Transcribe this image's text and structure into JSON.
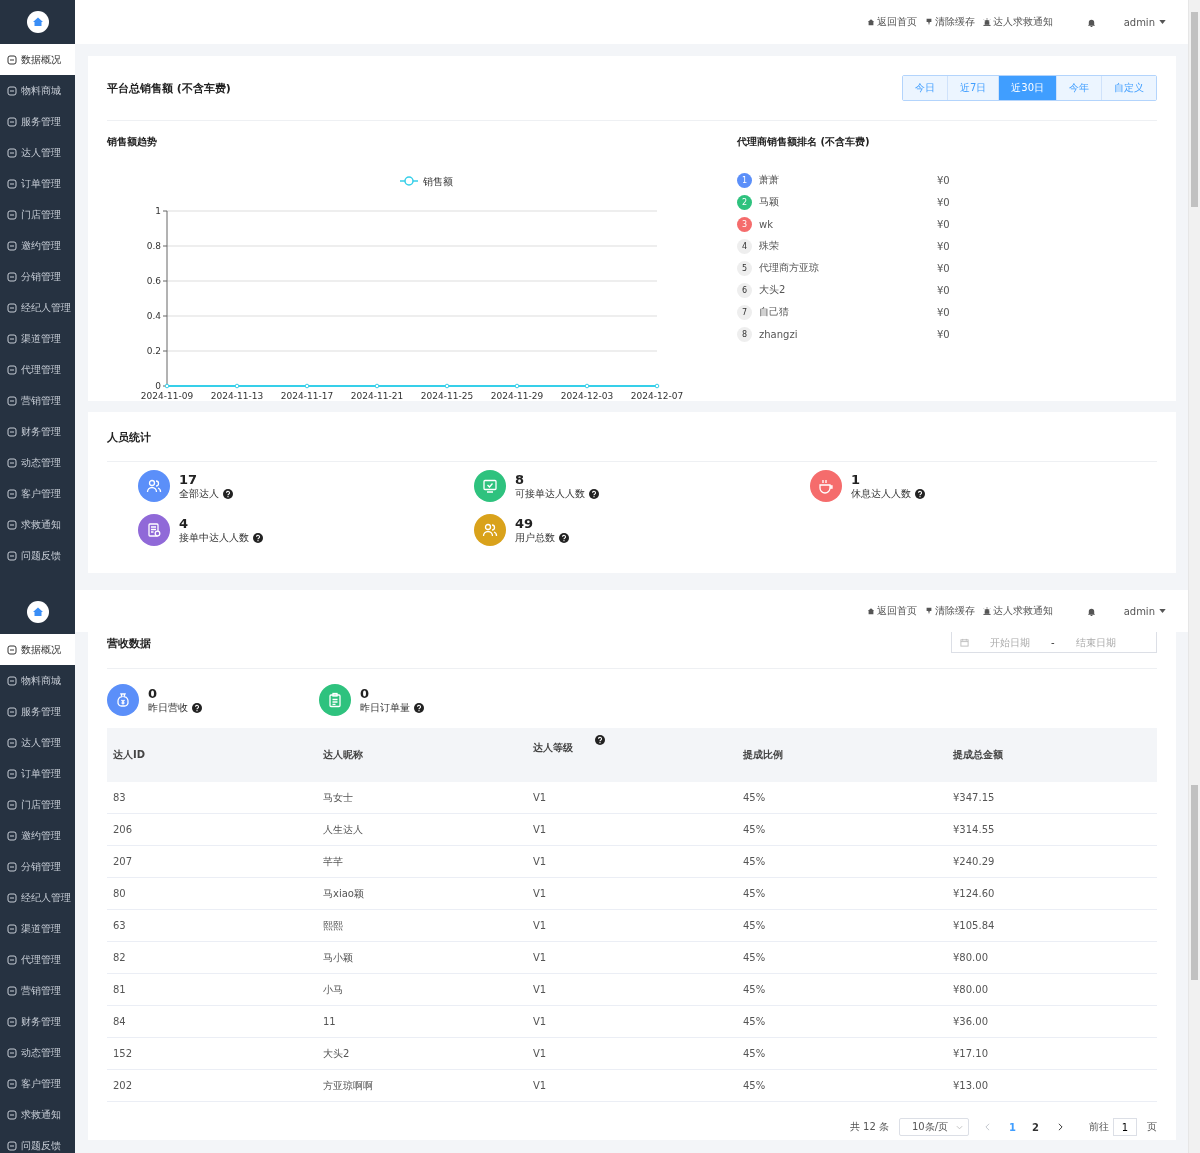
{
  "top_screen": {
    "sidebar": {
      "items": [
        {
          "label": "数据概况",
          "selected": true
        },
        {
          "label": "物料商城",
          "selected": false
        },
        {
          "label": "服务管理",
          "selected": false
        },
        {
          "label": "达人管理",
          "selected": false
        },
        {
          "label": "订单管理",
          "selected": false
        },
        {
          "label": "门店管理",
          "selected": false
        },
        {
          "label": "邀约管理",
          "selected": false
        },
        {
          "label": "分销管理",
          "selected": false
        },
        {
          "label": "经纪人管理",
          "selected": false
        },
        {
          "label": "渠道管理",
          "selected": false
        },
        {
          "label": "代理管理",
          "selected": false
        },
        {
          "label": "营销管理",
          "selected": false
        },
        {
          "label": "财务管理",
          "selected": false
        },
        {
          "label": "动态管理",
          "selected": false
        },
        {
          "label": "客户管理",
          "selected": false
        },
        {
          "label": "求救通知",
          "selected": false
        },
        {
          "label": "问题反馈",
          "selected": false
        }
      ]
    },
    "header": {
      "links": [
        {
          "kind": "home",
          "label": "返回首页"
        },
        {
          "kind": "clear",
          "label": "清除缓存"
        },
        {
          "kind": "alarm",
          "label": "达人求救通知"
        }
      ],
      "user": "admin"
    },
    "sales_card": {
      "title": "平台总销售额 (不含车费)",
      "ranges": [
        {
          "label": "今日",
          "selected": false
        },
        {
          "label": "近7日",
          "selected": false
        },
        {
          "label": "近30日",
          "selected": true
        },
        {
          "label": "今年",
          "selected": false
        },
        {
          "label": "自定义",
          "selected": false
        }
      ],
      "trend": {
        "title": "销售额趋势",
        "chart_data": {
          "type": "line",
          "categories": [
            "2024-11-09",
            "2024-11-13",
            "2024-11-17",
            "2024-11-21",
            "2024-11-25",
            "2024-11-29",
            "2024-12-03",
            "2024-12-07"
          ],
          "series": [
            {
              "name": "销售额",
              "color": "#36cfe9",
              "marker": "circle",
              "values": [
                0,
                0,
                0,
                0,
                0,
                0,
                0,
                0
              ]
            }
          ],
          "ylim": [
            0,
            1
          ],
          "yticks": [
            0,
            0.2,
            0.4,
            0.6,
            0.8,
            1
          ],
          "grid": true
        }
      },
      "ranking": {
        "title": "代理商销售额排名 (不含车费)",
        "rows": [
          {
            "rank": "1",
            "name": "萧萧",
            "amount": "¥0",
            "color": "#5b8ff9"
          },
          {
            "rank": "2",
            "name": "马颖",
            "amount": "¥0",
            "color": "#2ec27e"
          },
          {
            "rank": "3",
            "name": "wk",
            "amount": "¥0",
            "color": "#f56c6c"
          },
          {
            "rank": "4",
            "name": "殊荣",
            "amount": "¥0",
            "color": "#eeeeee"
          },
          {
            "rank": "5",
            "name": "代理商方亚琼",
            "amount": "¥0",
            "color": "#eeeeee"
          },
          {
            "rank": "6",
            "name": "大头2",
            "amount": "¥0",
            "color": "#eeeeee"
          },
          {
            "rank": "7",
            "name": "自己猜",
            "amount": "¥0",
            "color": "#eeeeee"
          },
          {
            "rank": "8",
            "name": "zhangzi",
            "amount": "¥0",
            "color": "#eeeeee"
          }
        ]
      }
    },
    "staff_card": {
      "title": "人员统计",
      "stats": [
        {
          "kind": "people",
          "value": "17",
          "label": "全部达人",
          "color": "#5b8ff9"
        },
        {
          "kind": "monitor",
          "value": "8",
          "label": "可接单达人人数",
          "color": "#2ec27e"
        },
        {
          "kind": "cup",
          "value": "1",
          "label": "休息达人人数",
          "color": "#f56c6c"
        },
        {
          "kind": "document",
          "value": "4",
          "label": "接单中达人人数",
          "color": "#9069d8"
        },
        {
          "kind": "users",
          "value": "49",
          "label": "用户总数",
          "color": "#d9a21b"
        }
      ]
    }
  },
  "bottom_screen": {
    "sidebar": {
      "items": [
        {
          "label": "数据概况",
          "selected": true
        },
        {
          "label": "物料商城",
          "selected": false
        },
        {
          "label": "服务管理",
          "selected": false
        },
        {
          "label": "达人管理",
          "selected": false
        },
        {
          "label": "订单管理",
          "selected": false
        },
        {
          "label": "门店管理",
          "selected": false
        },
        {
          "label": "邀约管理",
          "selected": false
        },
        {
          "label": "分销管理",
          "selected": false
        },
        {
          "label": "经纪人管理",
          "selected": false
        },
        {
          "label": "渠道管理",
          "selected": false
        },
        {
          "label": "代理管理",
          "selected": false
        },
        {
          "label": "营销管理",
          "selected": false
        },
        {
          "label": "财务管理",
          "selected": false
        },
        {
          "label": "动态管理",
          "selected": false
        },
        {
          "label": "客户管理",
          "selected": false
        },
        {
          "label": "求救通知",
          "selected": false
        },
        {
          "label": "问题反馈",
          "selected": false
        }
      ]
    },
    "header": {
      "links": [
        {
          "kind": "home",
          "label": "返回首页"
        },
        {
          "kind": "clear",
          "label": "清除缓存"
        },
        {
          "kind": "alarm",
          "label": "达人求救通知"
        }
      ],
      "user": "admin"
    },
    "revenue_card": {
      "title": "营收数据",
      "date_range": {
        "start_placeholder": "开始日期",
        "separator": "-",
        "end_placeholder": "结束日期"
      },
      "stats": [
        {
          "kind": "moneybag",
          "value": "0",
          "label": "昨日营收",
          "color": "#5b8ff9"
        },
        {
          "kind": "clipboard",
          "value": "0",
          "label": "昨日订单量",
          "color": "#2ec27e"
        }
      ],
      "table": {
        "columns": [
          {
            "label": "达人ID",
            "help": false
          },
          {
            "label": "达人昵称",
            "help": false
          },
          {
            "label": "达人等级",
            "help": true
          },
          {
            "label": "提成比例",
            "help": false
          },
          {
            "label": "提成总金额",
            "help": false
          }
        ],
        "rows": [
          [
            "83",
            "马女士",
            "V1",
            "45%",
            "¥347.15"
          ],
          [
            "206",
            "人生达人",
            "V1",
            "45%",
            "¥314.55"
          ],
          [
            "207",
            "芊芊",
            "V1",
            "45%",
            "¥240.29"
          ],
          [
            "80",
            "马xiao颖",
            "V1",
            "45%",
            "¥124.60"
          ],
          [
            "63",
            "熙熙",
            "V1",
            "45%",
            "¥105.84"
          ],
          [
            "82",
            "马小颖",
            "V1",
            "45%",
            "¥80.00"
          ],
          [
            "81",
            "小马",
            "V1",
            "45%",
            "¥80.00"
          ],
          [
            "84",
            "11",
            "V1",
            "45%",
            "¥36.00"
          ],
          [
            "152",
            "大头2",
            "V1",
            "45%",
            "¥17.10"
          ],
          [
            "202",
            "方亚琼啊啊",
            "V1",
            "45%",
            "¥13.00"
          ]
        ]
      },
      "pagination": {
        "total": "共 12 条",
        "page_size": "10条/页",
        "pages": [
          {
            "label": "1",
            "selected": true
          },
          {
            "label": "2",
            "selected": false
          }
        ],
        "goto_label": "前往",
        "goto_value": "1",
        "goto_suffix": "页"
      }
    }
  }
}
